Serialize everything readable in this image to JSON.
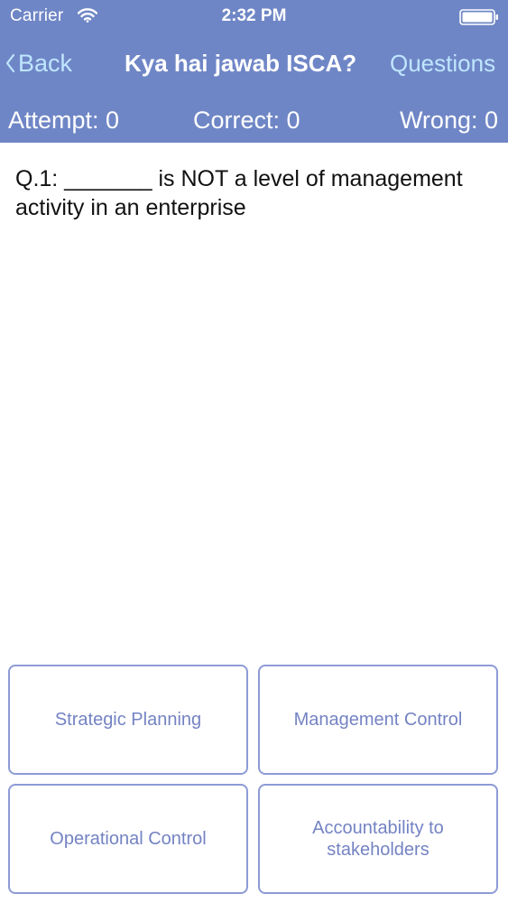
{
  "status_bar": {
    "carrier": "Carrier",
    "time": "2:32 PM",
    "icons": [
      "wifi-icon",
      "battery-icon"
    ]
  },
  "nav": {
    "back_label": "Back",
    "title": "Kya hai jawab ISCA?",
    "questions_label": "Questions"
  },
  "stats": {
    "attempt": "Attempt: 0",
    "correct": "Correct: 0",
    "wrong": "Wrong: 0"
  },
  "question": {
    "text": "Q.1: _______ is NOT a level of management activity in an enterprise"
  },
  "answers": [
    {
      "label": "Strategic Planning"
    },
    {
      "label": "Management Control"
    },
    {
      "label": "Operational Control"
    },
    {
      "label": "Accountability to stakeholders"
    }
  ],
  "colors": {
    "header_bg": "#6f86c6",
    "nav_link": "#bfe6ff",
    "answer_border": "#8d9bd6",
    "answer_text": "#7483c3"
  }
}
